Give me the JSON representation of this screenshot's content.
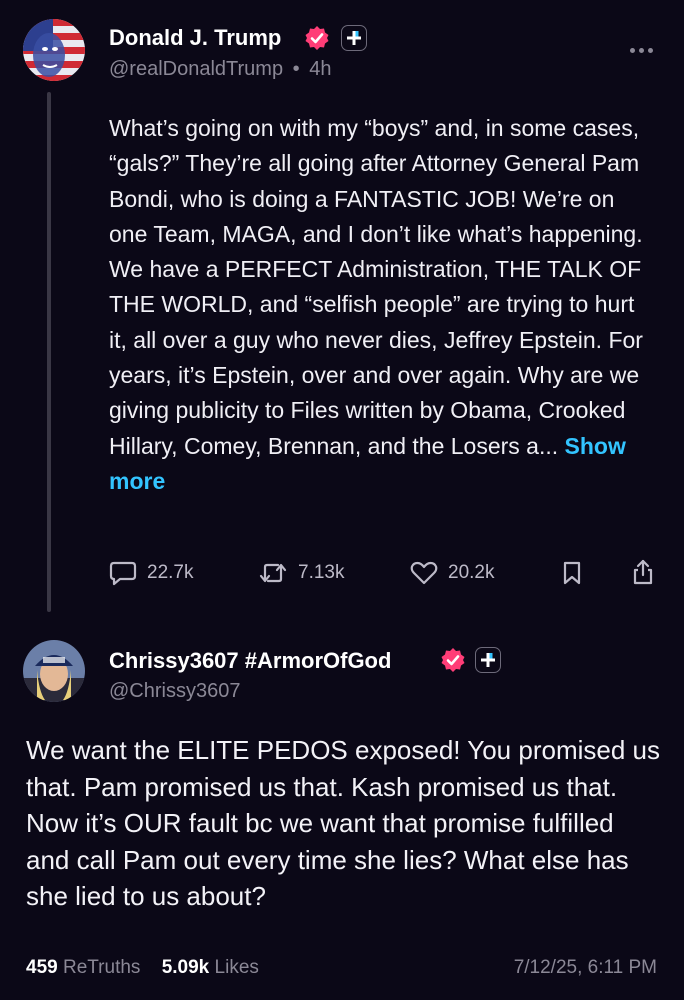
{
  "post": {
    "author_name": "Donald J. Trump",
    "handle": "@realDonaldTrump",
    "separator": "•",
    "time": "4h",
    "text": "What’s going on with my “boys” and, in some cases, “gals?” They’re all going after Attorney General Pam Bondi, who is doing a FANTASTIC JOB! We’re on one Team, MAGA, and I don’t like what’s happening. We have a PERFECT Administration, THE TALK OF THE WORLD, and “selfish people” are trying to hurt it, all over a guy who never dies, Jeffrey Epstein. For years, it’s Epstein, over and over again. Why are we giving publicity to Files written by Obama, Crooked Hillary, Comey, Brennan, and the Losers a...",
    "show_more": "Show more",
    "replies": "22.7k",
    "retruths": "7.13k",
    "likes": "20.2k"
  },
  "reply": {
    "author_name": "Chrissy3607 #ArmorOfGod",
    "handle": "@Chrissy3607",
    "text": "We want the ELITE PEDOS exposed! You promised us that. Pam promised us that. Kash promised us that. Now it’s OUR fault bc we want that promise fulfilled and call Pam out every time she lies? What else has she lied to us about?",
    "retruths_count": "459",
    "retruths_label": "ReTruths",
    "likes_count": "5.09k",
    "likes_label": "Likes",
    "timestamp": "7/12/25, 6:11 PM"
  },
  "colors": {
    "background": "#0b0817",
    "verified_badge": "#ff3d77",
    "link": "#33c4ff"
  },
  "icons": [
    "verified-badge-icon",
    "plus-icon",
    "more-options-icon",
    "reply-icon",
    "retruth-icon",
    "like-icon",
    "bookmark-icon",
    "share-icon"
  ]
}
